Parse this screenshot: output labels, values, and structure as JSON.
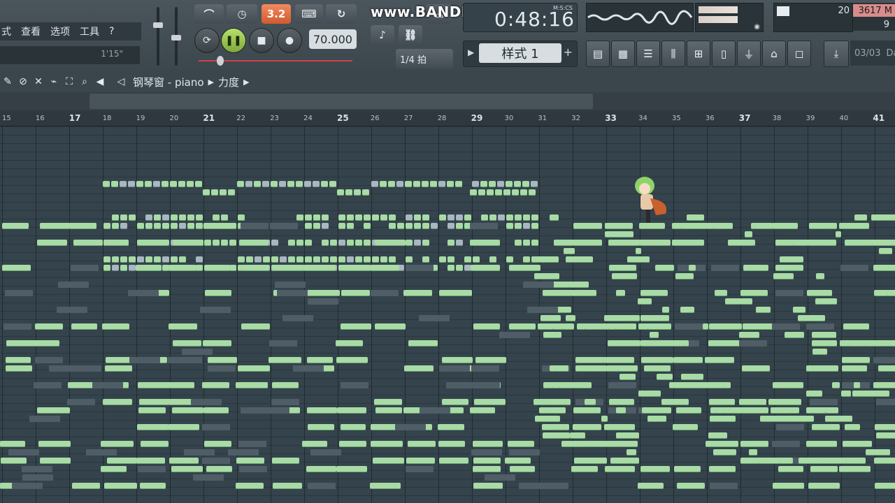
{
  "menu": {
    "items": [
      "式",
      "查看",
      "选项",
      "工具",
      "?"
    ]
  },
  "hint": {
    "time": "1'15\""
  },
  "transport": {
    "tempo": "70.000",
    "snap": "1/4 拍",
    "pattern_mode_label": "3.2",
    "play_state": "pause"
  },
  "watermark": "www.BANDICAM.com",
  "display": {
    "time": "0:48:16",
    "time_format": "M:S:CS"
  },
  "pattern": {
    "label": "样式 1"
  },
  "cpu": {
    "value": "20"
  },
  "memory": {
    "used": "3617 M",
    "polyphony": "9"
  },
  "date": {
    "label": "03/03",
    "extra": "Da"
  },
  "pianoroll": {
    "breadcrumb": [
      "钢琴窗 - piano",
      "力度"
    ]
  },
  "ruler": {
    "labels": [
      "15",
      "16",
      "17",
      "18",
      "19",
      "20",
      "21",
      "22",
      "23",
      "24",
      "25",
      "26",
      "27",
      "28",
      "29",
      "30",
      "31",
      "32",
      "33",
      "34",
      "35",
      "36",
      "37",
      "38",
      "39",
      "40",
      "41"
    ]
  },
  "colors": {
    "note": "#a8dba6",
    "note_selected": "#a9b7c2",
    "background": "#34434c",
    "accent_red": "#cc4444"
  }
}
